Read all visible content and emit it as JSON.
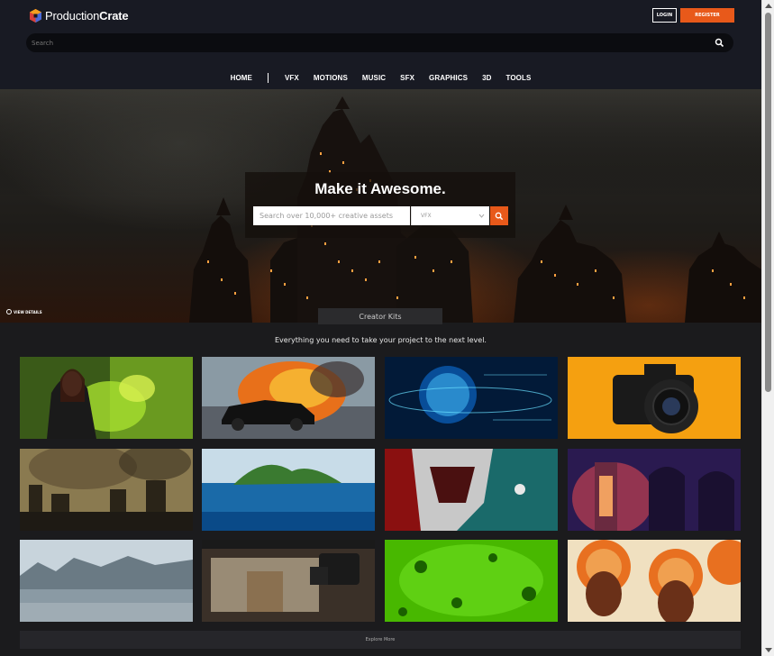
{
  "header": {
    "logo_part1": "Production",
    "logo_part2": "Crate",
    "login_label": "LOGIN",
    "register_label": "REGISTER",
    "search_placeholder": "Search"
  },
  "nav": {
    "items": [
      "HOME",
      "VFX",
      "MOTIONS",
      "MUSIC",
      "SFX",
      "GRAPHICS",
      "3D",
      "TOOLS"
    ]
  },
  "hero": {
    "title": "Make it Awesome.",
    "search_placeholder": "Search over 10,000+ creative assets",
    "category_selected": "VFX",
    "view_details": "VIEW DETAILS"
  },
  "section": {
    "tab_label": "Creator Kits",
    "tagline": "Everything you need to take your project to the next level.",
    "explore_label": "Explore More"
  },
  "tiles": [
    {
      "name": "witch-green-magic",
      "colors": [
        "#2c3a18",
        "#5aa020",
        "#c9e830"
      ]
    },
    {
      "name": "car-explosion",
      "colors": [
        "#b4c4cc",
        "#e87a20",
        "#1a1a1a"
      ]
    },
    {
      "name": "hologram-globe",
      "colors": [
        "#021630",
        "#0a5aa0",
        "#6ee8ff"
      ]
    },
    {
      "name": "camera-orange",
      "colors": [
        "#f5a010",
        "#e88a00",
        "#1a1a1a"
      ]
    },
    {
      "name": "ruined-city",
      "colors": [
        "#8a7a50",
        "#4a4030",
        "#1e1a14"
      ]
    },
    {
      "name": "island-ocean",
      "colors": [
        "#b8d4e8",
        "#1a6aa8",
        "#3a7a30"
      ]
    },
    {
      "name": "shark-astronaut",
      "colors": [
        "#a01010",
        "#1a6a6a",
        "#e8e8e8"
      ]
    },
    {
      "name": "glowing-ruins",
      "colors": [
        "#3a2060",
        "#c04050",
        "#f0a060"
      ]
    },
    {
      "name": "foggy-forest",
      "colors": [
        "#c8d4dc",
        "#8a9aa4",
        "#4a5a64"
      ]
    },
    {
      "name": "film-set-camera",
      "colors": [
        "#d8c8a8",
        "#5a4a38",
        "#1a1a1a"
      ]
    },
    {
      "name": "green-screen-virus",
      "colors": [
        "#60d010",
        "#2a9a00",
        "#1a6000"
      ]
    },
    {
      "name": "thanksgiving-turkeys",
      "colors": [
        "#f0e0c0",
        "#e87020",
        "#6a3018"
      ]
    }
  ]
}
